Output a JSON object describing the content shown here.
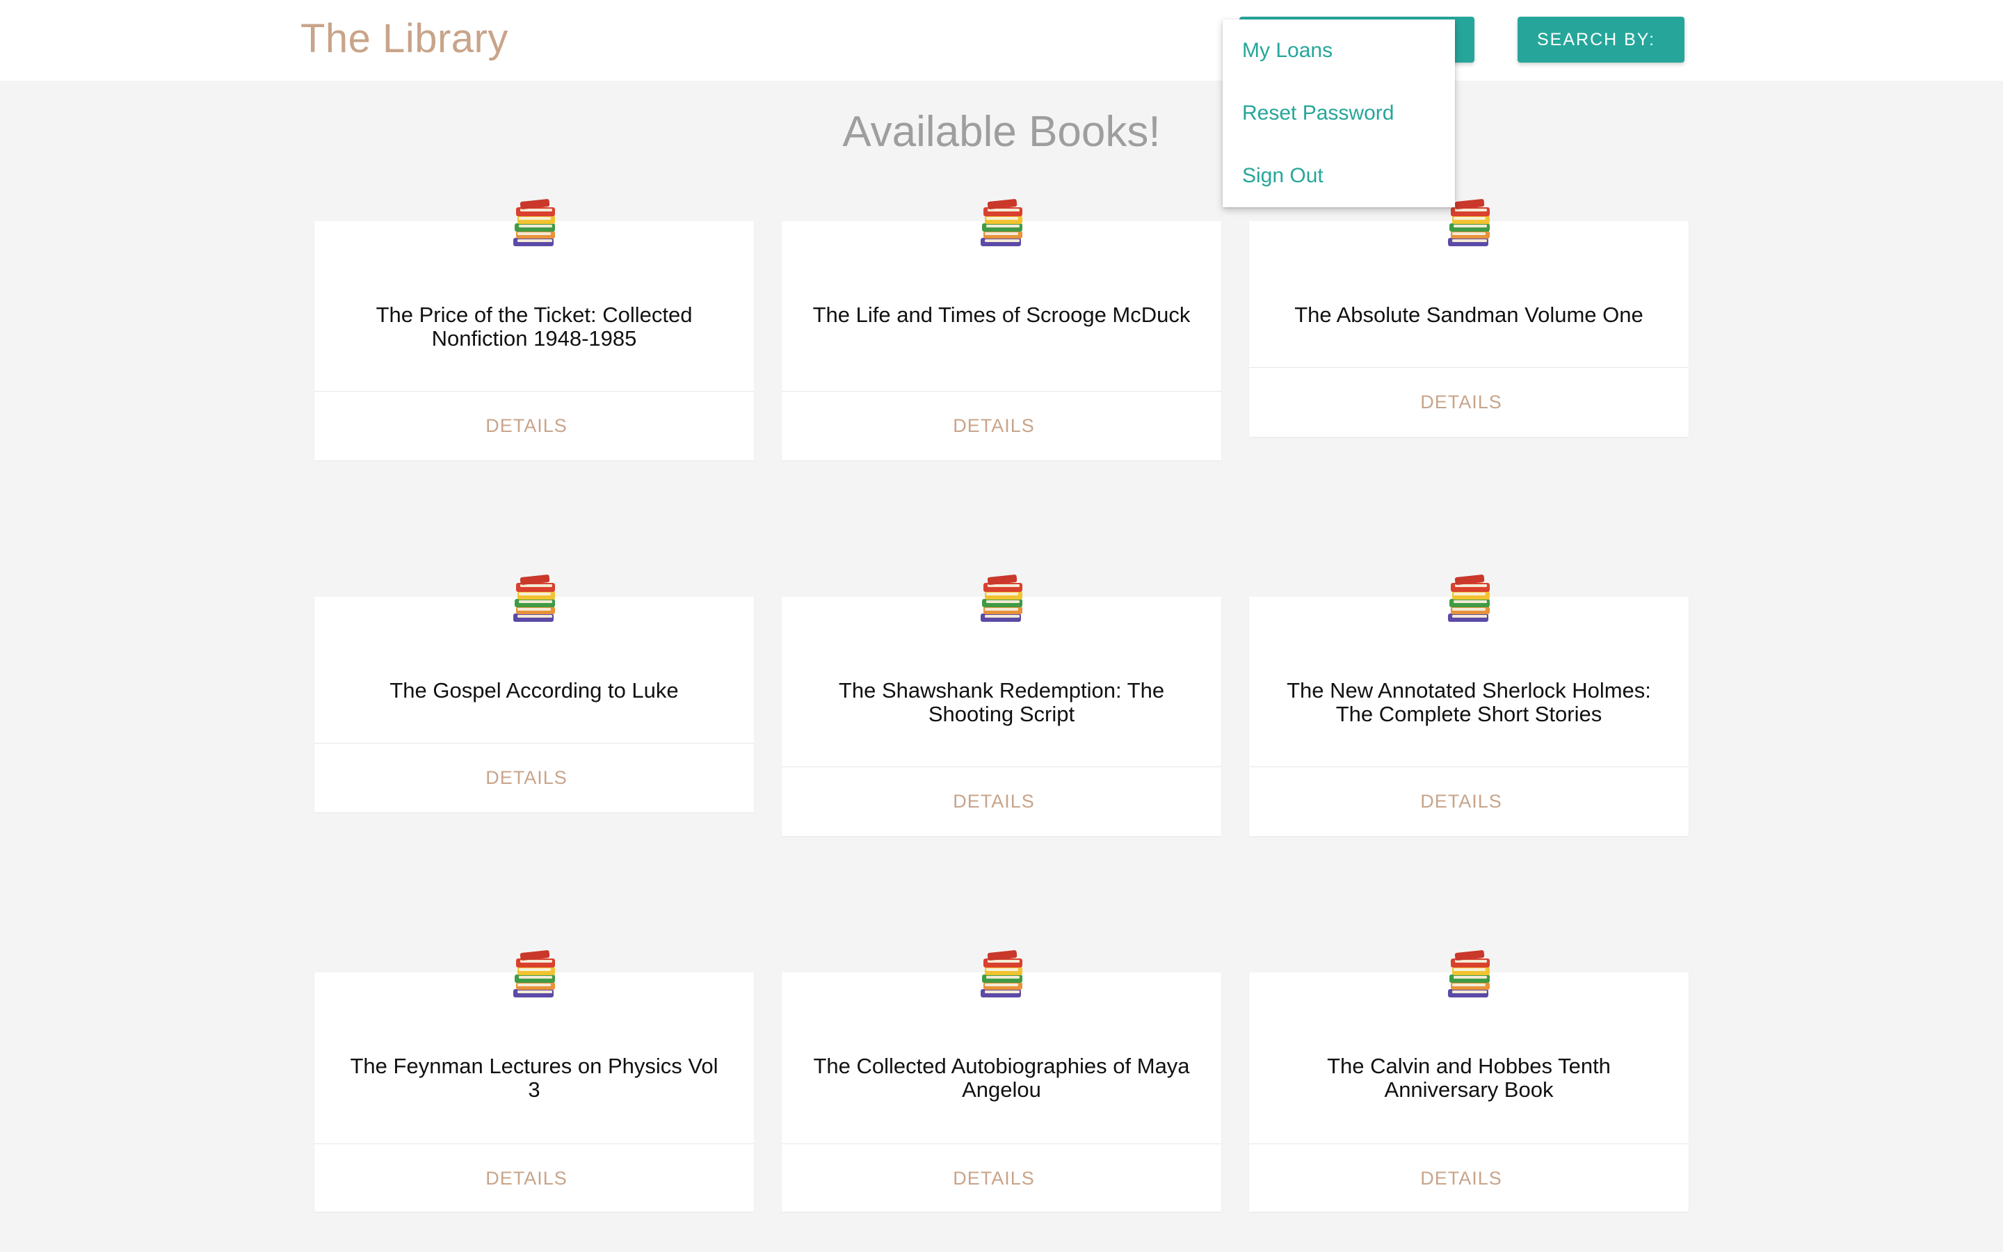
{
  "app": {
    "brand": "The Library"
  },
  "navbar": {
    "search_label": "SEARCH BY:",
    "account_label": ""
  },
  "dropdown": {
    "items": [
      {
        "label": "My Loans"
      },
      {
        "label": "Reset Password"
      },
      {
        "label": "Sign Out"
      }
    ]
  },
  "main": {
    "heading": "Available Books!",
    "books": [
      {
        "title": "The Price of the Ticket: Collected Nonfiction 1948-1985",
        "action": "DETAILS"
      },
      {
        "title": "The Life and Times of Scrooge McDuck",
        "action": "DETAILS"
      },
      {
        "title": "The Absolute Sandman Volume One",
        "action": "DETAILS"
      },
      {
        "title": "The Gospel According to Luke",
        "action": "DETAILS"
      },
      {
        "title": "The Shawshank Redemption: The Shooting Script",
        "action": "DETAILS"
      },
      {
        "title": "The New Annotated Sherlock Holmes: The Complete Short Stories",
        "action": "DETAILS"
      },
      {
        "title": "The Feynman Lectures on Physics Vol 3",
        "action": "DETAILS"
      },
      {
        "title": "The Collected Autobiographies of Maya Angelou",
        "action": "DETAILS"
      },
      {
        "title": "The Calvin and Hobbes Tenth Anniversary Book",
        "action": "DETAILS"
      }
    ]
  },
  "icons": {
    "book_stack": "books-icon"
  },
  "colors": {
    "accent": "#26a69a",
    "brand": "#c8a48a",
    "heading": "#9e9e9e"
  }
}
